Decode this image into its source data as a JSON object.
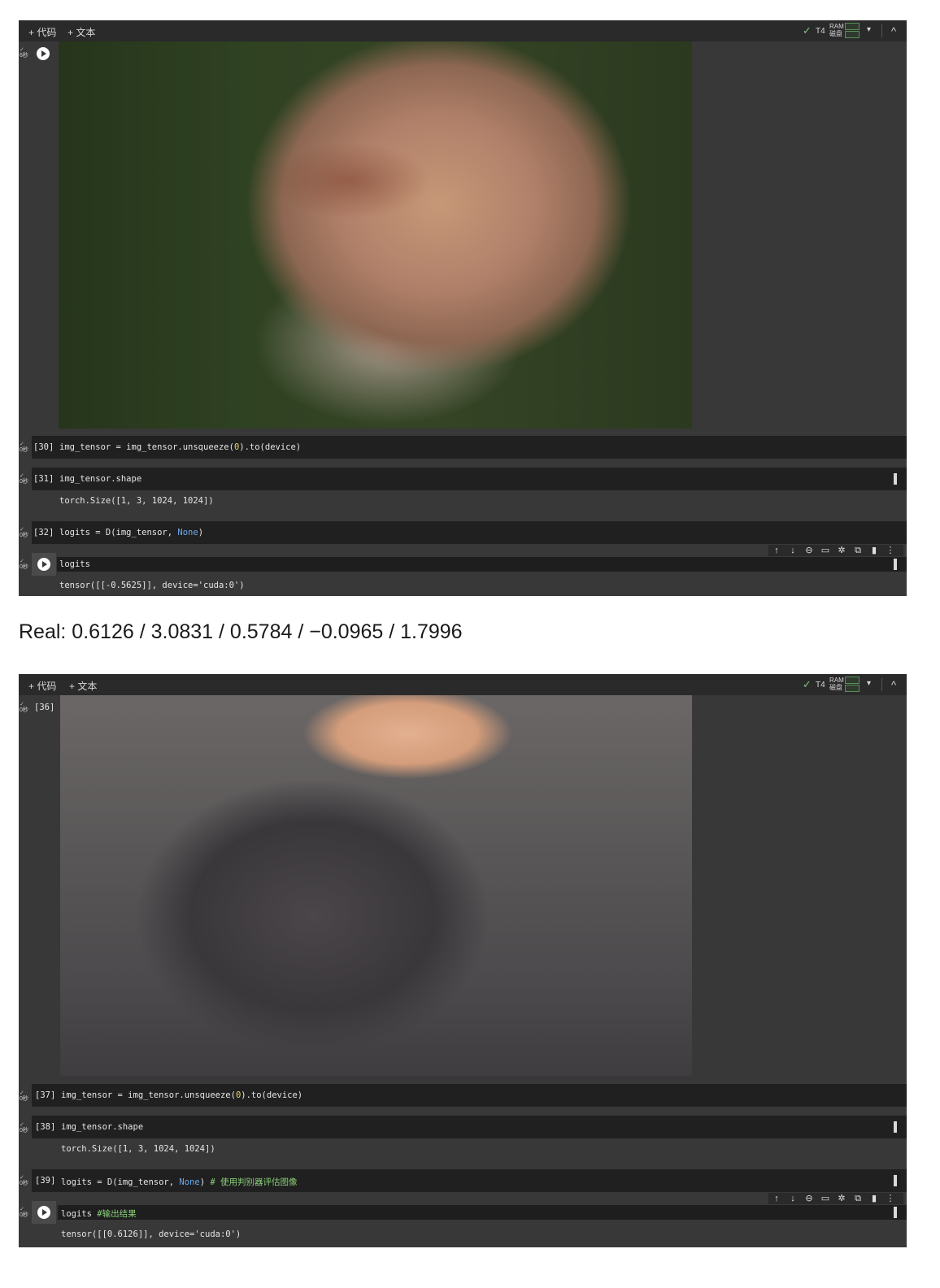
{
  "caption": "Real: 0.6126 / 3.0831 / 0.5784 / −0.0965 / 1.7996",
  "toolbar": {
    "add_code": "+ 代码",
    "add_text": "+ 文本",
    "check": "✓",
    "gpu": "T4",
    "ram": "RAM",
    "disk": "磁盘",
    "caret": "▾",
    "collapse": "^"
  },
  "status": {
    "check": "✓",
    "sec": "0秒",
    "sec6": "6秒"
  },
  "cell_tools": [
    "↑",
    "↓",
    "⊖",
    "▭",
    "✲",
    "⧉",
    "▮",
    "⋮"
  ],
  "panel1": {
    "cells": [
      {
        "prompt": "[30]",
        "code": [
          "img_tensor = img_tensor.unsqueeze(",
          "0",
          ").to(device)"
        ]
      },
      {
        "prompt": "[31]",
        "code": [
          "img_tensor.shape"
        ],
        "output": "torch.Size([1, 3, 1024, 1024])"
      },
      {
        "prompt": "[32]",
        "code": [
          "logits = D(img_tensor, ",
          "None",
          ")"
        ]
      },
      {
        "code": [
          "logits"
        ],
        "output": "tensor([[-0.5625]], device='cuda:0')"
      }
    ]
  },
  "panel2": {
    "first_prompt": "[36]",
    "cells": [
      {
        "prompt": "[37]",
        "code": [
          "img_tensor = img_tensor.unsqueeze(",
          "0",
          ").to(device)"
        ]
      },
      {
        "prompt": "[38]",
        "code": [
          "img_tensor.shape"
        ],
        "output": "torch.Size([1, 3, 1024, 1024])"
      },
      {
        "prompt": "[39]",
        "code": [
          "logits = D(img_tensor, ",
          "None",
          ") ",
          "# 使用判别器评估图像"
        ]
      },
      {
        "code": [
          "logits ",
          "#输出结果"
        ],
        "output": "tensor([[0.6126]], device='cuda:0')"
      }
    ]
  }
}
